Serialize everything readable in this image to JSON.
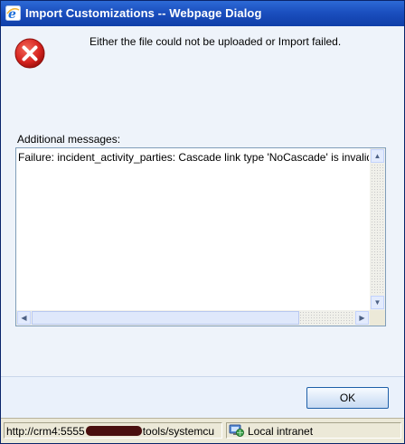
{
  "window": {
    "title": "Import Customizations -- Webpage Dialog",
    "title_icon": "ie-icon"
  },
  "dialog": {
    "icon": "error-icon",
    "message": "Either the file could not be uploaded or Import failed.",
    "additional_label": "Additional messages:",
    "details_text": "Failure: incident_activity_parties: Cascade link type 'NoCascade' is invalid for Delete.",
    "ok_label": "OK"
  },
  "statusbar": {
    "url_prefix": "http://crm4:5555",
    "url_suffix": "tools/systemcu",
    "zone_label": "Local intranet",
    "zone_icon": "globe-icon"
  },
  "colors": {
    "titlebar": "#1b4fbf",
    "error_red": "#d6231f",
    "dialog_bg": "#eef3fa"
  }
}
